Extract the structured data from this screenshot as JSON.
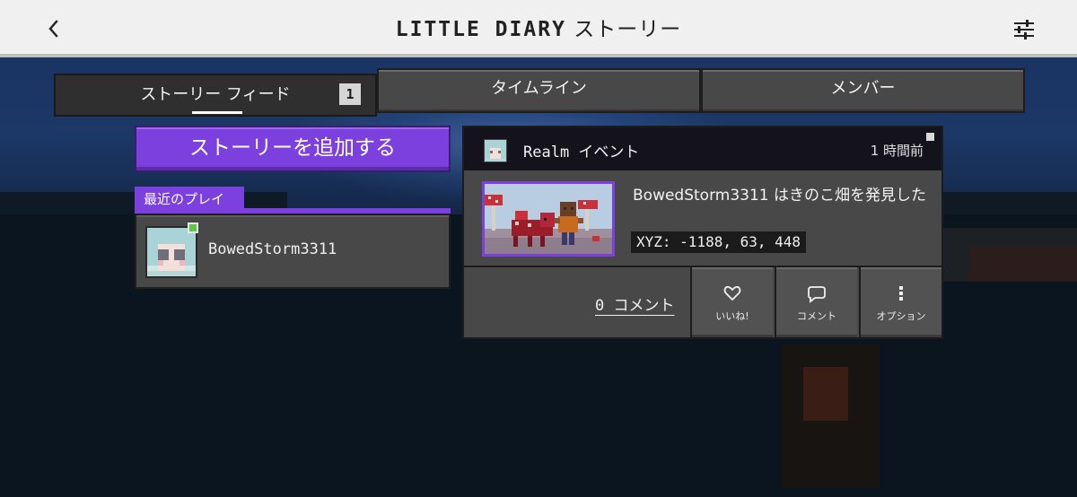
{
  "header": {
    "brand": "LITTLE DIARY",
    "title": "ストーリー",
    "back_icon": "chevron-left-icon",
    "filter_icon": "sliders-icon"
  },
  "tabs": [
    {
      "label": "ストーリー フィード",
      "badge": "1",
      "active": true
    },
    {
      "label": "タイムライン",
      "active": false
    },
    {
      "label": "メンバー",
      "active": false
    }
  ],
  "sidebar": {
    "add_story_label": "ストーリーを追加する",
    "recent_label": "最近のプレイ",
    "recent_player": "BowedStorm3311",
    "online_status_color": "#5ec549"
  },
  "story": {
    "source": "Realm イベント",
    "time": "1 時間前",
    "text": "BowedStorm3311 はきのこ畑を発見した",
    "coords": "XYZ: -1188, 63, 448",
    "comment_count": "0 コメント",
    "actions": [
      {
        "label": "いいね!",
        "icon": "heart-icon"
      },
      {
        "label": "コメント",
        "icon": "speech-bubble-icon"
      },
      {
        "label": "オプション",
        "icon": "more-vertical-icon"
      }
    ]
  },
  "colors": {
    "accent": "#7b40dd",
    "panel": "#484848",
    "topbar": "#f0f0f0"
  }
}
